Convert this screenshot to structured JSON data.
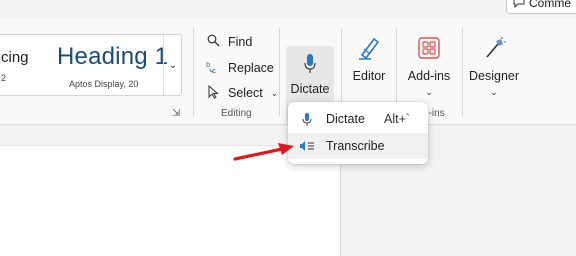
{
  "top": {
    "comments_label": "Comme"
  },
  "styles": {
    "left_style_name": "cing",
    "left_style_sub": "2",
    "heading_name": "Heading 1",
    "heading_sub": "Aptos Display, 20"
  },
  "editing": {
    "find": "Find",
    "replace": "Replace",
    "select": "Select",
    "group_label": "Editing"
  },
  "voice": {
    "dictate_label": "Dictate"
  },
  "editor": {
    "label": "Editor"
  },
  "addins": {
    "label": "Add-ins",
    "group_label": "d-ins"
  },
  "designer": {
    "label": "Designer"
  },
  "dictate_menu": {
    "items": [
      {
        "label": "Dictate",
        "shortcut": "Alt+`"
      },
      {
        "label": "Transcribe",
        "shortcut": ""
      }
    ]
  },
  "colors": {
    "heading": "#1a4c7a",
    "accent_blue": "#2b78c5",
    "arrow_red": "#e0191f"
  }
}
